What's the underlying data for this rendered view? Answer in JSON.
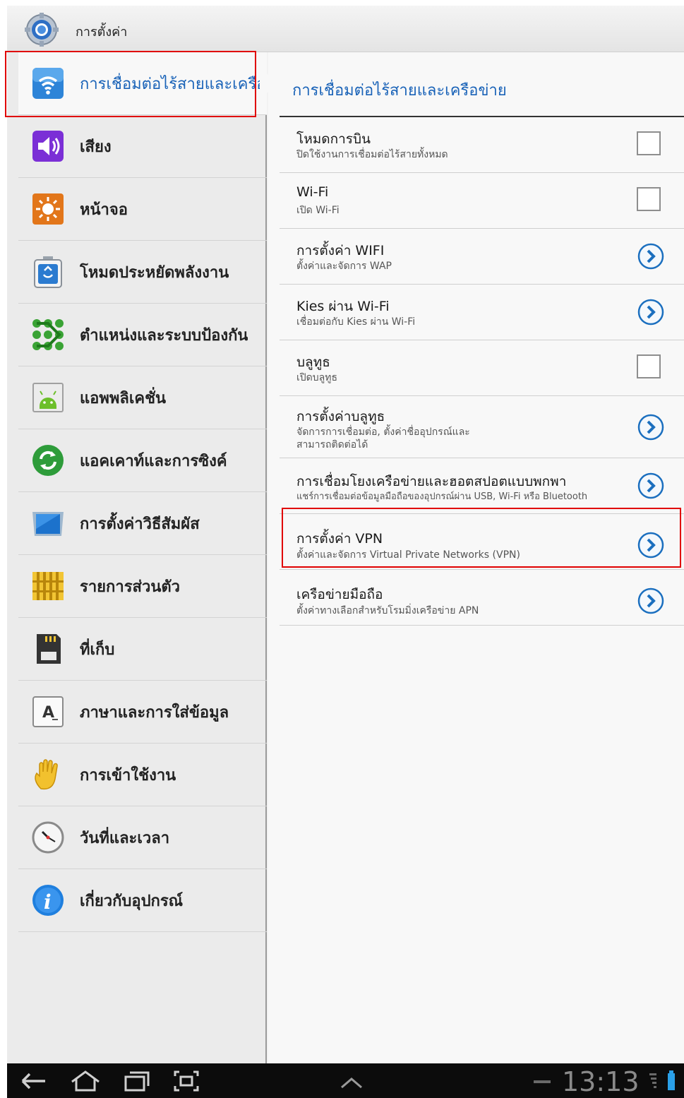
{
  "header": {
    "title": "การตั้งค่า",
    "icon": "gear-icon"
  },
  "sidebar": {
    "items": [
      {
        "label": "การเชื่อมต่อไร้สายและเครือข่าย",
        "icon": "wifi-icon",
        "active": true
      },
      {
        "label": "เสียง",
        "icon": "speaker-icon"
      },
      {
        "label": "หน้าจอ",
        "icon": "brightness-icon"
      },
      {
        "label": "โหมดประหยัดพลังงาน",
        "icon": "power-saving-icon"
      },
      {
        "label": "ตำแหน่งและระบบป้องกัน",
        "icon": "location-security-icon"
      },
      {
        "label": "แอพพลิเคชั่น",
        "icon": "android-icon"
      },
      {
        "label": "แอคเคาท์และการซิงค์",
        "icon": "sync-icon"
      },
      {
        "label": "การตั้งค่าวิธีสัมผัส",
        "icon": "motion-icon"
      },
      {
        "label": "รายการส่วนตัว",
        "icon": "privacy-icon"
      },
      {
        "label": "ที่เก็บ",
        "icon": "sd-card-icon"
      },
      {
        "label": "ภาษาและการใส่ข้อมูล",
        "icon": "keyboard-icon"
      },
      {
        "label": "การเข้าใช้งาน",
        "icon": "hand-icon"
      },
      {
        "label": "วันที่และเวลา",
        "icon": "clock-icon"
      },
      {
        "label": "เกี่ยวกับอุปกรณ์",
        "icon": "info-icon"
      }
    ]
  },
  "content": {
    "title": "การเชื่อมต่อไร้สายและเครือข่าย",
    "rows": [
      {
        "title": "โหมดการบิน",
        "subtitle": "ปิดใช้งานการเชื่อมต่อไร้สายทั้งหมด",
        "control": "checkbox",
        "checked": false
      },
      {
        "title": "Wi-Fi",
        "subtitle": "เปิด Wi-Fi",
        "control": "checkbox",
        "checked": false
      },
      {
        "title": "การตั้งค่า WIFI",
        "subtitle": "ตั้งค่าและจัดการ WAP",
        "control": "arrow"
      },
      {
        "title": "Kies ผ่าน Wi-Fi",
        "subtitle": "เชื่อมต่อกับ Kies ผ่าน Wi-Fi",
        "control": "arrow"
      },
      {
        "title": "บลูทูธ",
        "subtitle": "เปิดบลูทูธ",
        "control": "checkbox",
        "checked": false
      },
      {
        "title": "การตั้งค่าบลูทูธ",
        "subtitle": "จัดการการเชื่อมต่อ, ตั้งค่าชื่ออุปกรณ์และ",
        "subtitle2": "สามารถติดต่อได้",
        "control": "arrow"
      },
      {
        "title": "การเชื่อมโยงเครือข่ายและฮอตสปอตแบบพกพา",
        "subtitle": "แชร์การเชื่อมต่อข้อมูลมือถือของอุปกรณ์ผ่าน USB, Wi-Fi หรือ Bluetooth",
        "control": "arrow"
      },
      {
        "title": "การตั้งค่า VPN",
        "subtitle": "ตั้งค่าและจัดการ Virtual Private Networks (VPN)",
        "control": "arrow"
      },
      {
        "title": "เครือข่ายมือถือ",
        "subtitle": "ตั้งค่าทางเลือกสำหรับโรมมิ่งเครือข่าย APN",
        "control": "arrow"
      }
    ]
  },
  "statusbar": {
    "time": "13:13"
  },
  "navigation": {
    "back": "back-icon",
    "home": "home-icon",
    "recent": "recent-apps-icon",
    "screenshot": "screenshot-icon",
    "up": "chevron-up-icon"
  },
  "colors": {
    "accent": "#1a63b8",
    "highlight": "#e00000"
  }
}
